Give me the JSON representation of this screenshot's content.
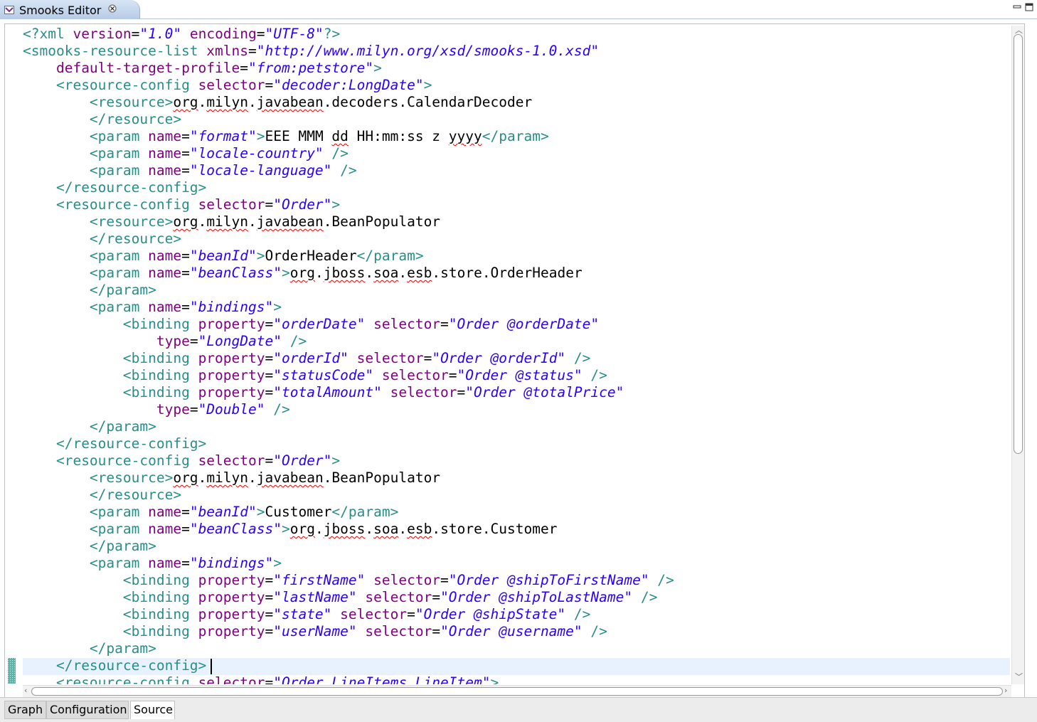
{
  "window": {
    "tab_title": "Smooks Editor",
    "tab_icon": "smooks-editor-icon",
    "close_icon": "close-icon",
    "minimize_icon": "minimize-icon",
    "maximize_icon": "maximize-icon"
  },
  "editor": {
    "cursor_line": 38,
    "lines": [
      [
        [
          "tag",
          "<?xml "
        ],
        [
          "attr",
          "version"
        ],
        [
          "txt",
          "="
        ],
        [
          "val",
          "\"1.0\""
        ],
        [
          "txt",
          " "
        ],
        [
          "attr",
          "encoding"
        ],
        [
          "txt",
          "="
        ],
        [
          "val",
          "\"UTF-8\""
        ],
        [
          "tag",
          "?>"
        ]
      ],
      [
        [
          "tag",
          "<smooks-resource-list "
        ],
        [
          "attr",
          "xmlns"
        ],
        [
          "txt",
          "="
        ],
        [
          "val",
          "\"http://www.milyn.org/xsd/smooks-1.0.xsd\""
        ]
      ],
      [
        [
          "txt",
          "    "
        ],
        [
          "attr",
          "default-target-profile"
        ],
        [
          "txt",
          "="
        ],
        [
          "val",
          "\"from:petstore\""
        ],
        [
          "tag",
          ">"
        ]
      ],
      [
        [
          "txt",
          "    "
        ],
        [
          "tag",
          "<resource-config "
        ],
        [
          "attr",
          "selector"
        ],
        [
          "txt",
          "="
        ],
        [
          "val",
          "\"decoder:LongDate\""
        ],
        [
          "tag",
          ">"
        ]
      ],
      [
        [
          "txt",
          "        "
        ],
        [
          "tag",
          "<resource>"
        ],
        [
          "txtsq",
          "org"
        ],
        [
          "txt",
          "."
        ],
        [
          "txtsq",
          "milyn"
        ],
        [
          "txt",
          "."
        ],
        [
          "txtsq",
          "javabean"
        ],
        [
          "txt",
          ".decoders.CalendarDecoder"
        ]
      ],
      [
        [
          "txt",
          "        "
        ],
        [
          "tag",
          "</resource>"
        ]
      ],
      [
        [
          "txt",
          "        "
        ],
        [
          "tag",
          "<param "
        ],
        [
          "attr",
          "name"
        ],
        [
          "txt",
          "="
        ],
        [
          "val",
          "\"format\""
        ],
        [
          "tag",
          ">"
        ],
        [
          "txt",
          "EEE MMM "
        ],
        [
          "txtsq",
          "dd"
        ],
        [
          "txt",
          " HH:mm:ss z "
        ],
        [
          "txtsq",
          "yyyy"
        ],
        [
          "tag",
          "</param>"
        ]
      ],
      [
        [
          "txt",
          "        "
        ],
        [
          "tag",
          "<param "
        ],
        [
          "attr",
          "name"
        ],
        [
          "txt",
          "="
        ],
        [
          "val",
          "\"locale-country\""
        ],
        [
          "tag",
          " />"
        ]
      ],
      [
        [
          "txt",
          "        "
        ],
        [
          "tag",
          "<param "
        ],
        [
          "attr",
          "name"
        ],
        [
          "txt",
          "="
        ],
        [
          "val",
          "\"locale-language\""
        ],
        [
          "tag",
          " />"
        ]
      ],
      [
        [
          "txt",
          "    "
        ],
        [
          "tag",
          "</resource-config>"
        ]
      ],
      [
        [
          "txt",
          "    "
        ],
        [
          "tag",
          "<resource-config "
        ],
        [
          "attr",
          "selector"
        ],
        [
          "txt",
          "="
        ],
        [
          "val",
          "\"Order\""
        ],
        [
          "tag",
          ">"
        ]
      ],
      [
        [
          "txt",
          "        "
        ],
        [
          "tag",
          "<resource>"
        ],
        [
          "txtsq",
          "org"
        ],
        [
          "txt",
          "."
        ],
        [
          "txtsq",
          "milyn"
        ],
        [
          "txt",
          "."
        ],
        [
          "txtsq",
          "javabean"
        ],
        [
          "txt",
          ".BeanPopulator"
        ]
      ],
      [
        [
          "txt",
          "        "
        ],
        [
          "tag",
          "</resource>"
        ]
      ],
      [
        [
          "txt",
          "        "
        ],
        [
          "tag",
          "<param "
        ],
        [
          "attr",
          "name"
        ],
        [
          "txt",
          "="
        ],
        [
          "val",
          "\"beanId\""
        ],
        [
          "tag",
          ">"
        ],
        [
          "txt",
          "OrderHeader"
        ],
        [
          "tag",
          "</param>"
        ]
      ],
      [
        [
          "txt",
          "        "
        ],
        [
          "tag",
          "<param "
        ],
        [
          "attr",
          "name"
        ],
        [
          "txt",
          "="
        ],
        [
          "val",
          "\"beanClass\""
        ],
        [
          "tag",
          ">"
        ],
        [
          "txtsq",
          "org"
        ],
        [
          "txt",
          "."
        ],
        [
          "txtsq",
          "jboss"
        ],
        [
          "txt",
          "."
        ],
        [
          "txtsq",
          "soa"
        ],
        [
          "txt",
          "."
        ],
        [
          "txtsq",
          "esb"
        ],
        [
          "txt",
          ".store.OrderHeader"
        ]
      ],
      [
        [
          "txt",
          "        "
        ],
        [
          "tag",
          "</param>"
        ]
      ],
      [
        [
          "txt",
          "        "
        ],
        [
          "tag",
          "<param "
        ],
        [
          "attr",
          "name"
        ],
        [
          "txt",
          "="
        ],
        [
          "val",
          "\"bindings\""
        ],
        [
          "tag",
          ">"
        ]
      ],
      [
        [
          "txt",
          "            "
        ],
        [
          "tag",
          "<binding "
        ],
        [
          "attr",
          "property"
        ],
        [
          "txt",
          "="
        ],
        [
          "val",
          "\"orderDate\""
        ],
        [
          "txt",
          " "
        ],
        [
          "attr",
          "selector"
        ],
        [
          "txt",
          "="
        ],
        [
          "val",
          "\"Order @orderDate\""
        ]
      ],
      [
        [
          "txt",
          "                "
        ],
        [
          "attr",
          "type"
        ],
        [
          "txt",
          "="
        ],
        [
          "val",
          "\"LongDate\""
        ],
        [
          "tag",
          " />"
        ]
      ],
      [
        [
          "txt",
          "            "
        ],
        [
          "tag",
          "<binding "
        ],
        [
          "attr",
          "property"
        ],
        [
          "txt",
          "="
        ],
        [
          "val",
          "\"orderId\""
        ],
        [
          "txt",
          " "
        ],
        [
          "attr",
          "selector"
        ],
        [
          "txt",
          "="
        ],
        [
          "val",
          "\"Order @orderId\""
        ],
        [
          "tag",
          " />"
        ]
      ],
      [
        [
          "txt",
          "            "
        ],
        [
          "tag",
          "<binding "
        ],
        [
          "attr",
          "property"
        ],
        [
          "txt",
          "="
        ],
        [
          "val",
          "\"statusCode\""
        ],
        [
          "txt",
          " "
        ],
        [
          "attr",
          "selector"
        ],
        [
          "txt",
          "="
        ],
        [
          "val",
          "\"Order @status\""
        ],
        [
          "tag",
          " />"
        ]
      ],
      [
        [
          "txt",
          "            "
        ],
        [
          "tag",
          "<binding "
        ],
        [
          "attr",
          "property"
        ],
        [
          "txt",
          "="
        ],
        [
          "val",
          "\"totalAmount\""
        ],
        [
          "txt",
          " "
        ],
        [
          "attr",
          "selector"
        ],
        [
          "txt",
          "="
        ],
        [
          "val",
          "\"Order @totalPrice\""
        ]
      ],
      [
        [
          "txt",
          "                "
        ],
        [
          "attr",
          "type"
        ],
        [
          "txt",
          "="
        ],
        [
          "val",
          "\"Double\""
        ],
        [
          "tag",
          " />"
        ]
      ],
      [
        [
          "txt",
          "        "
        ],
        [
          "tag",
          "</param>"
        ]
      ],
      [
        [
          "txt",
          "    "
        ],
        [
          "tag",
          "</resource-config>"
        ]
      ],
      [
        [
          "txt",
          "    "
        ],
        [
          "tag",
          "<resource-config "
        ],
        [
          "attr",
          "selector"
        ],
        [
          "txt",
          "="
        ],
        [
          "val",
          "\"Order\""
        ],
        [
          "tag",
          ">"
        ]
      ],
      [
        [
          "txt",
          "        "
        ],
        [
          "tag",
          "<resource>"
        ],
        [
          "txtsq",
          "org"
        ],
        [
          "txt",
          "."
        ],
        [
          "txtsq",
          "milyn"
        ],
        [
          "txt",
          "."
        ],
        [
          "txtsq",
          "javabean"
        ],
        [
          "txt",
          ".BeanPopulator"
        ]
      ],
      [
        [
          "txt",
          "        "
        ],
        [
          "tag",
          "</resource>"
        ]
      ],
      [
        [
          "txt",
          "        "
        ],
        [
          "tag",
          "<param "
        ],
        [
          "attr",
          "name"
        ],
        [
          "txt",
          "="
        ],
        [
          "val",
          "\"beanId\""
        ],
        [
          "tag",
          ">"
        ],
        [
          "txt",
          "Customer"
        ],
        [
          "tag",
          "</param>"
        ]
      ],
      [
        [
          "txt",
          "        "
        ],
        [
          "tag",
          "<param "
        ],
        [
          "attr",
          "name"
        ],
        [
          "txt",
          "="
        ],
        [
          "val",
          "\"beanClass\""
        ],
        [
          "tag",
          ">"
        ],
        [
          "txtsq",
          "org"
        ],
        [
          "txt",
          "."
        ],
        [
          "txtsq",
          "jboss"
        ],
        [
          "txt",
          "."
        ],
        [
          "txtsq",
          "soa"
        ],
        [
          "txt",
          "."
        ],
        [
          "txtsq",
          "esb"
        ],
        [
          "txt",
          ".store.Customer"
        ]
      ],
      [
        [
          "txt",
          "        "
        ],
        [
          "tag",
          "</param>"
        ]
      ],
      [
        [
          "txt",
          "        "
        ],
        [
          "tag",
          "<param "
        ],
        [
          "attr",
          "name"
        ],
        [
          "txt",
          "="
        ],
        [
          "val",
          "\"bindings\""
        ],
        [
          "tag",
          ">"
        ]
      ],
      [
        [
          "txt",
          "            "
        ],
        [
          "tag",
          "<binding "
        ],
        [
          "attr",
          "property"
        ],
        [
          "txt",
          "="
        ],
        [
          "val",
          "\"firstName\""
        ],
        [
          "txt",
          " "
        ],
        [
          "attr",
          "selector"
        ],
        [
          "txt",
          "="
        ],
        [
          "val",
          "\"Order @shipToFirstName\""
        ],
        [
          "tag",
          " />"
        ]
      ],
      [
        [
          "txt",
          "            "
        ],
        [
          "tag",
          "<binding "
        ],
        [
          "attr",
          "property"
        ],
        [
          "txt",
          "="
        ],
        [
          "val",
          "\"lastName\""
        ],
        [
          "txt",
          " "
        ],
        [
          "attr",
          "selector"
        ],
        [
          "txt",
          "="
        ],
        [
          "val",
          "\"Order @shipToLastName\""
        ],
        [
          "tag",
          " />"
        ]
      ],
      [
        [
          "txt",
          "            "
        ],
        [
          "tag",
          "<binding "
        ],
        [
          "attr",
          "property"
        ],
        [
          "txt",
          "="
        ],
        [
          "val",
          "\"state\""
        ],
        [
          "txt",
          " "
        ],
        [
          "attr",
          "selector"
        ],
        [
          "txt",
          "="
        ],
        [
          "val",
          "\"Order @shipState\""
        ],
        [
          "tag",
          " />"
        ]
      ],
      [
        [
          "txt",
          "            "
        ],
        [
          "tag",
          "<binding "
        ],
        [
          "attr",
          "property"
        ],
        [
          "txt",
          "="
        ],
        [
          "val",
          "\"userName\""
        ],
        [
          "txt",
          " "
        ],
        [
          "attr",
          "selector"
        ],
        [
          "txt",
          "="
        ],
        [
          "val",
          "\"Order @username\""
        ],
        [
          "tag",
          " />"
        ]
      ],
      [
        [
          "txt",
          "        "
        ],
        [
          "tag",
          "</param>"
        ]
      ],
      [
        [
          "txt",
          "    "
        ],
        [
          "tag",
          "</resource-config>"
        ]
      ],
      [
        [
          "txt",
          "    "
        ],
        [
          "tag",
          "<resource-config "
        ],
        [
          "attr",
          "selector"
        ],
        [
          "txt",
          "="
        ],
        [
          "val",
          "\"Order LineItems LineItem\""
        ],
        [
          "tag",
          ">"
        ]
      ]
    ]
  },
  "bottom_tabs": [
    {
      "label": "Graph",
      "active": false
    },
    {
      "label": "Configuration",
      "active": false
    },
    {
      "label": "Source",
      "active": true
    }
  ]
}
